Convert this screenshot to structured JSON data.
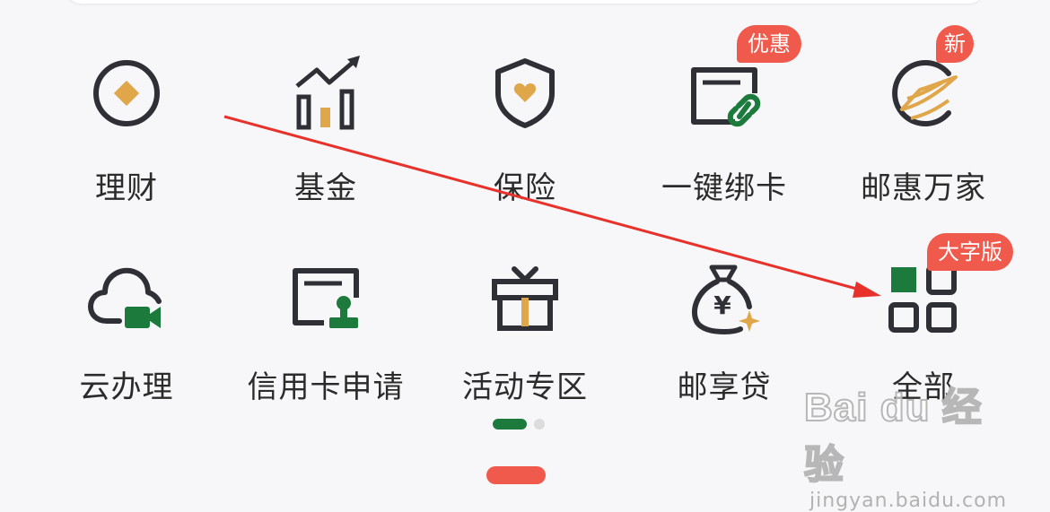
{
  "colors": {
    "accent_green": "#1c7a3c",
    "gold": "#e0a64a",
    "badge_red": "#ef5a4c",
    "icon_dark": "#2f2f36",
    "arrow_red": "#e8312b"
  },
  "menu": {
    "items": [
      {
        "label": "理财",
        "icon": "coin-icon"
      },
      {
        "label": "基金",
        "icon": "growth-chart-icon"
      },
      {
        "label": "保险",
        "icon": "shield-heart-icon"
      },
      {
        "label": "一键绑卡",
        "icon": "card-link-icon",
        "badge": "优惠"
      },
      {
        "label": "邮惠万家",
        "icon": "postal-wings-icon",
        "badge": "新"
      },
      {
        "label": "云办理",
        "icon": "cloud-video-icon"
      },
      {
        "label": "信用卡申请",
        "icon": "card-stamp-icon"
      },
      {
        "label": "活动专区",
        "icon": "gift-box-icon"
      },
      {
        "label": "邮享贷",
        "icon": "money-bag-icon"
      },
      {
        "label": "全部",
        "icon": "all-grid-icon",
        "badge": "大字版"
      }
    ]
  },
  "pagination": {
    "pages": 2,
    "current": 1
  },
  "watermark": {
    "logo": "Bai du 经验",
    "url": "jingyan.baidu.com"
  }
}
